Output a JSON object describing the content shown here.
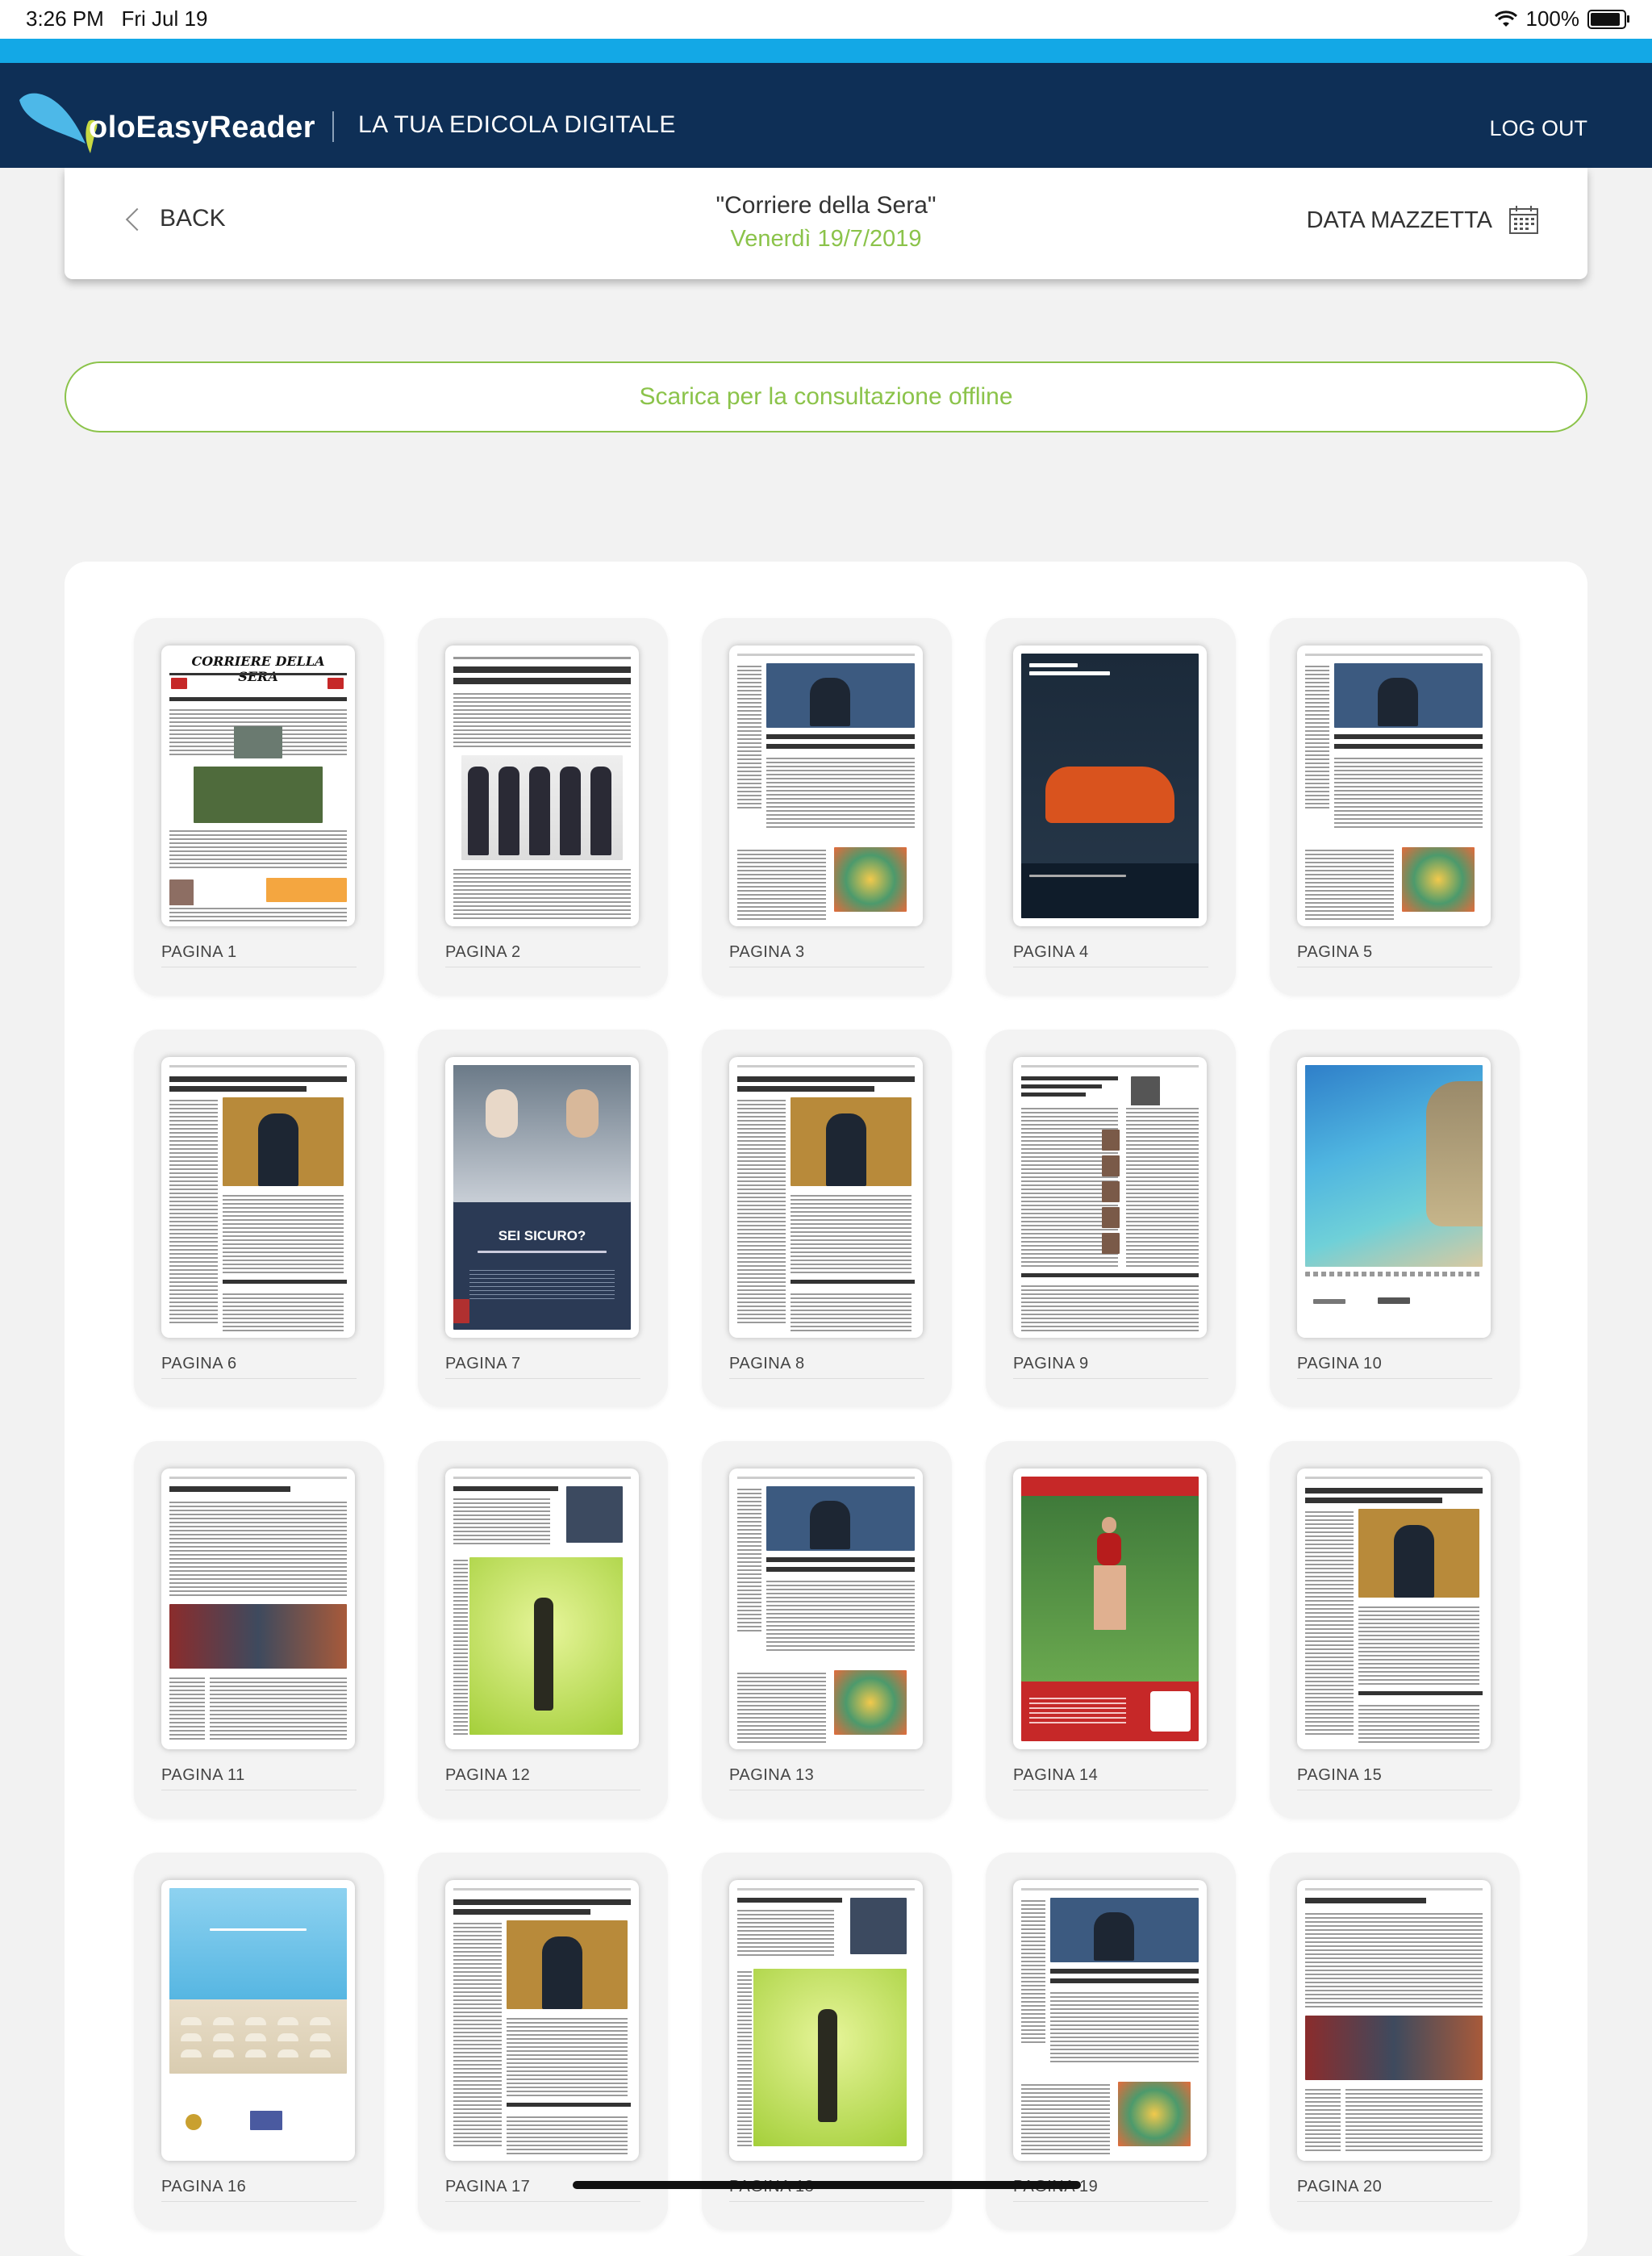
{
  "status_bar": {
    "time": "3:26 PM",
    "date": "Fri Jul 19",
    "battery": "100%",
    "battery_level": 1.0
  },
  "header": {
    "app_name": "oloEasyReader",
    "tagline": "LA TUA EDICOLA DIGITALE",
    "logout_label": "LOG OUT"
  },
  "nav": {
    "back_label": "BACK",
    "title": "\"Corriere della Sera\"",
    "date": "Venerdì 19/7/2019",
    "date_picker_label": "DATA MAZZETTA"
  },
  "download_button_label": "Scarica per la consultazione offline",
  "pages": [
    {
      "label": "PAGINA 1",
      "style": "front",
      "masthead": "CORRIERE DELLA SERA"
    },
    {
      "label": "PAGINA 2",
      "style": "article-people"
    },
    {
      "label": "PAGINA 3",
      "style": "article-photo-top"
    },
    {
      "label": "PAGINA 4",
      "style": "ad-car"
    },
    {
      "label": "PAGINA 5",
      "style": "article-photo-top"
    },
    {
      "label": "PAGINA 6",
      "style": "article-photo-mid"
    },
    {
      "label": "PAGINA 7",
      "style": "ad-dark",
      "ad_text": "SEI SICURO?"
    },
    {
      "label": "PAGINA 8",
      "style": "article-photo-mid"
    },
    {
      "label": "PAGINA 9",
      "style": "article-text"
    },
    {
      "label": "PAGINA 10",
      "style": "ad-sea"
    },
    {
      "label": "PAGINA 11",
      "style": "article-photo-low"
    },
    {
      "label": "PAGINA 12",
      "style": "ad-green"
    },
    {
      "label": "PAGINA 13",
      "style": "article-photo-top"
    },
    {
      "label": "PAGINA 14",
      "style": "ad-run"
    },
    {
      "label": "PAGINA 15",
      "style": "article-photo-mid"
    },
    {
      "label": "PAGINA 16",
      "style": "ad-beach"
    },
    {
      "label": "PAGINA 17",
      "style": "article-photo-mid"
    },
    {
      "label": "PAGINA 18",
      "style": "ad-green"
    },
    {
      "label": "PAGINA 19",
      "style": "article-photo-top"
    },
    {
      "label": "PAGINA 20",
      "style": "article-photo-low"
    }
  ],
  "colors": {
    "accent_green": "#8bc34a",
    "header_navy": "#0e2f56",
    "top_cyan": "#13a8e6"
  }
}
